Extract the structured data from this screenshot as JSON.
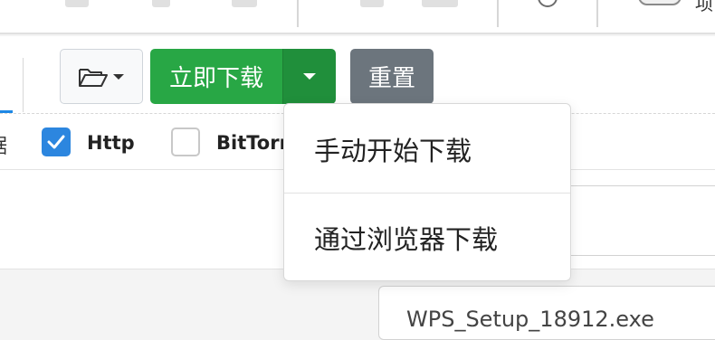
{
  "toolbar": {
    "cut_label": "项"
  },
  "actions": {
    "primary_label": "立即下载",
    "reset_label": "重置"
  },
  "protocols": {
    "cut_prefix": "据",
    "http_label": "Http",
    "http_checked": true,
    "bittorrent_label": "BitTorr"
  },
  "dropdown": {
    "items": [
      {
        "label": "手动开始下载"
      },
      {
        "label": "通过浏览器下载"
      }
    ]
  },
  "file": {
    "name": "WPS_Setup_18912.exe"
  },
  "colors": {
    "primary": "#28a745",
    "primary_dark": "#208f3b",
    "secondary": "#6c757d",
    "checkbox": "#2c86df",
    "tab_active": "#1e88e5"
  }
}
